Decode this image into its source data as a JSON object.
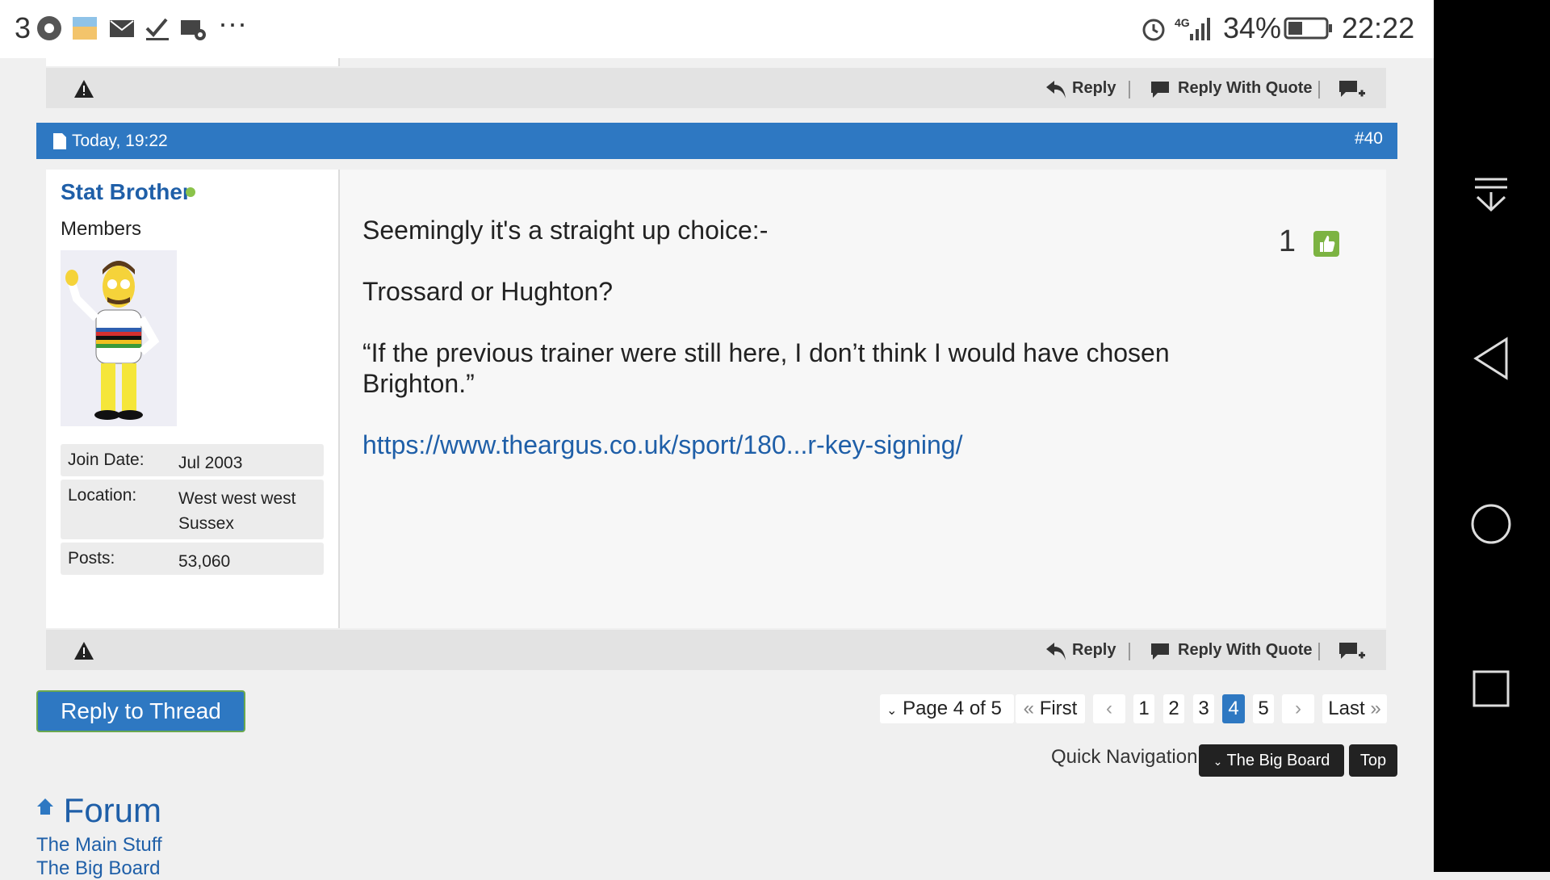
{
  "status_bar": {
    "notif_count": "3",
    "battery": "34%",
    "time": "22:22",
    "network": "4G"
  },
  "post": {
    "top_actions": {
      "reply": "Reply",
      "reply_quote": "Reply With Quote"
    },
    "date": "Today, 19:22",
    "number": "#40",
    "user": {
      "name": "Stat Brother",
      "title": "Members",
      "join_label": "Join Date:",
      "join_value": "Jul 2003",
      "location_label": "Location:",
      "location_value": "West west west Sussex",
      "posts_label": "Posts:",
      "posts_value": "53,060"
    },
    "lines": [
      "Seemingly it's a straight up choice:-",
      "Trossard or Hughton?",
      "“If the previous trainer were still here, I don’t think I would have chosen Brighton.”"
    ],
    "link": "https://www.theargus.co.uk/sport/180...r-key-signing/",
    "likes": "1",
    "bottom_actions": {
      "reply": "Reply",
      "reply_quote": "Reply With Quote"
    }
  },
  "reply_thread": "Reply to Thread",
  "pagination": {
    "page_of": "Page 4 of 5",
    "first": "First",
    "pages": [
      "1",
      "2",
      "3",
      "4",
      "5"
    ],
    "current": "4",
    "last": "Last"
  },
  "quick_nav": {
    "label": "Quick Navigation",
    "board": "The Big Board",
    "top": "Top"
  },
  "footer": {
    "forum": "Forum",
    "links": [
      "The Main Stuff",
      "The Big Board"
    ]
  },
  "colors": {
    "accent": "#2e78c2",
    "link": "#1f5fa8",
    "like": "#7cb342"
  }
}
